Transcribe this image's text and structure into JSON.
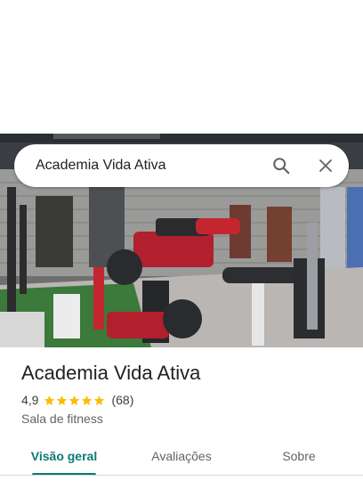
{
  "search": {
    "query": "Academia Vida Ativa"
  },
  "place": {
    "name": "Academia Vida Ativa",
    "rating": "4,9",
    "rating_value": 4.9,
    "stars_max": 5,
    "reviews_count": "(68)",
    "category": "Sala de fitness"
  },
  "tabs": [
    {
      "label": "Visão geral",
      "active": true
    },
    {
      "label": "Avaliações",
      "active": false
    },
    {
      "label": "Sobre",
      "active": false
    }
  ],
  "icons": {
    "search": "search-icon",
    "close": "close-icon",
    "star": "star-icon"
  },
  "colors": {
    "accent": "#0b7a73",
    "star": "#fbbc04"
  }
}
